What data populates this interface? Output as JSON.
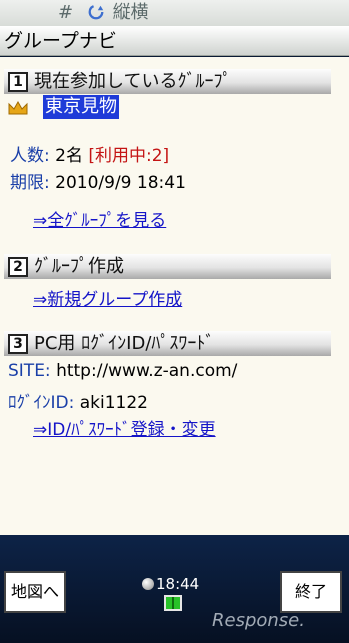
{
  "status_bar": {
    "text": "#",
    "rotate_icon": "rotate-icon",
    "orientation_label": "縦横"
  },
  "title_bar": {
    "title": "グループナビ"
  },
  "section1": {
    "number": "1",
    "title": "現在参加しているｸﾞﾙｰﾌﾟ",
    "group_name": "東京見物",
    "members_label": "人数:",
    "members_value": "2名",
    "usage_status": "[利用中:2]",
    "expiry_label": "期限:",
    "expiry_value": "2010/9/9 18:41",
    "view_all_link": "⇒全ｸﾞﾙｰﾌﾟを見る"
  },
  "section2": {
    "number": "2",
    "title": "ｸﾞﾙｰﾌﾟ作成",
    "new_group_link": "⇒新規グループ作成"
  },
  "section3": {
    "number": "3",
    "title": "PC用 ﾛｸﾞｲﾝID/ﾊﾟｽﾜｰﾄﾞ",
    "site_label": "SITE:",
    "site_url": "http://www.z-an.com/",
    "login_label": "ﾛｸﾞｲﾝID:",
    "login_value": "aki1122",
    "register_link": "⇒ID/ﾊﾟｽﾜｰﾄﾞ登録・変更"
  },
  "bottom_bar": {
    "left_button": "地図へ",
    "right_button": "終了",
    "clock": "18:44",
    "battery_level": 1.0
  },
  "watermark": "Response."
}
